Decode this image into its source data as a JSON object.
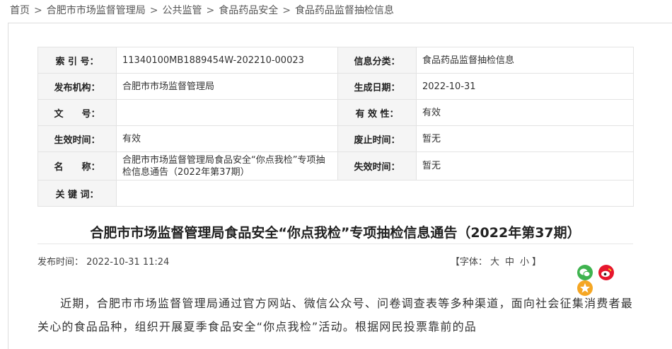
{
  "breadcrumb": {
    "items": [
      "首页",
      "合肥市市场监督管理局",
      "公共监管",
      "食品药品安全",
      "食品药品监督抽检信息"
    ],
    "separator": ">"
  },
  "meta": {
    "index_label": "索 引 号：",
    "index_value": "11340100MB1889454W-202210-00023",
    "category_label": "信息分类：",
    "category_value": "食品药品监督抽检信息",
    "publisher_label": "发布机构：",
    "publisher_value": "合肥市市场监督管理局",
    "created_label": "生成日期：",
    "created_value": "2022-10-31",
    "docno_label": "文　　号：",
    "docno_value": "",
    "validity_label": "有 效 性：",
    "validity_value": "有效",
    "effective_label": "生效时间：",
    "effective_value": "有效",
    "repeal_label": "废止时间：",
    "repeal_value": "暂无",
    "name_label": "名　　称：",
    "name_value": "合肥市市场监督管理局食品安全“你点我检”专项抽检信息通告（2022年第37期）",
    "expire_label": "失效时间：",
    "expire_value": "暂无",
    "keywords_label": "关 键 词：",
    "keywords_value": ""
  },
  "article": {
    "title": "合肥市市场监督管理局食品安全“你点我检”专项抽检信息通告（2022年第37期）",
    "publish_time": "发布时间： 2022-10-31 11:24",
    "font_label": "【字体：",
    "font_large": "大",
    "font_medium": "中",
    "font_small": "小",
    "font_close": "】",
    "body": "近期，合肥市市场监督管理局通过官方网站、微信公众号、问卷调查表等多种渠道，面向社会征集消费者最关心的食品品种，组织开展夏季食品安全“你点我检”活动。根据网民投票靠前的品"
  },
  "share": {
    "icons": [
      "wechat-icon",
      "weibo-icon",
      "qzone-icon"
    ],
    "colors": [
      "#3fb34f",
      "#e6162d",
      "#f5a623"
    ]
  }
}
